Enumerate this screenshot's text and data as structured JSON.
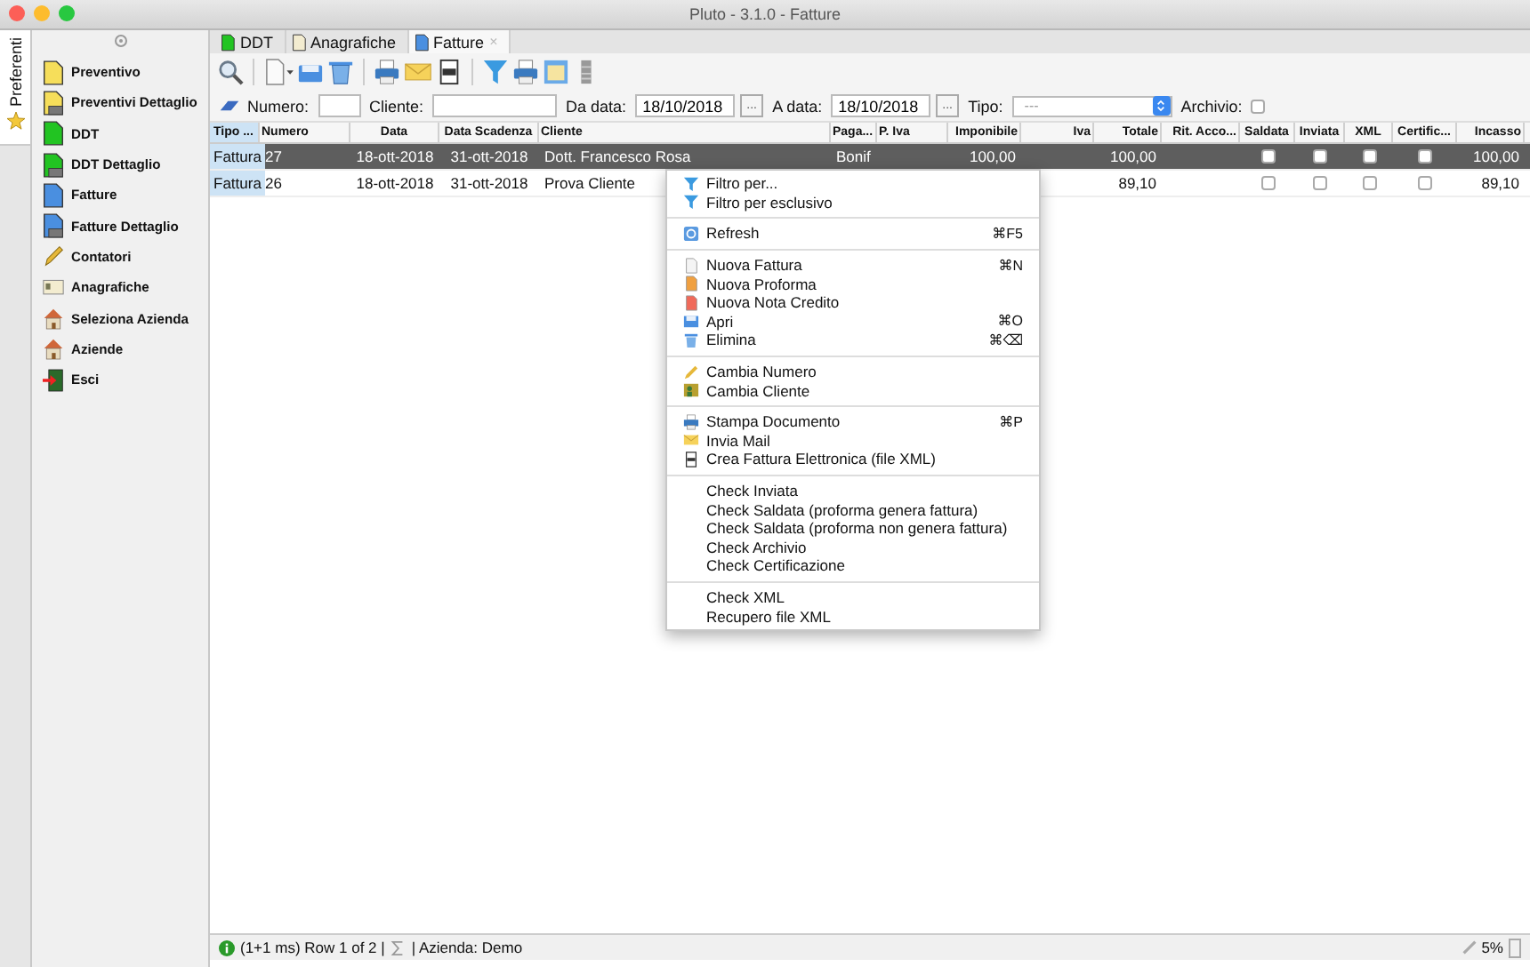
{
  "window": {
    "title": "Pluto - 3.1.0 - Fatture"
  },
  "side_tab": {
    "label": "Preferenti",
    "selected": true
  },
  "sidebar": {
    "items": [
      {
        "label": "Preventivo"
      },
      {
        "label": "Preventivi Dettaglio"
      },
      {
        "label": "DDT"
      },
      {
        "label": "DDT Dettaglio"
      },
      {
        "label": "Fatture"
      },
      {
        "label": "Fatture Dettaglio"
      },
      {
        "label": "Contatori"
      },
      {
        "label": "Anagrafiche"
      },
      {
        "label": "Seleziona Azienda"
      },
      {
        "label": "Aziende"
      },
      {
        "label": "Esci"
      }
    ]
  },
  "tabs": [
    {
      "label": "DDT",
      "selected": false
    },
    {
      "label": "Anagrafiche",
      "selected": false
    },
    {
      "label": "Fatture",
      "selected": true,
      "close": "×"
    }
  ],
  "filters": {
    "numero_label": "Numero:",
    "cliente_label": "Cliente:",
    "da_data_label": "Da data:",
    "da_data": "18/10/2018",
    "a_data_label": "A data:",
    "a_data": "18/10/2018",
    "browse": "...",
    "tipo_label": "Tipo:",
    "tipo": "---",
    "archivio_label": "Archivio:",
    "archivio": false
  },
  "table": {
    "columns": [
      {
        "label": "Tipo ...",
        "kind": "tag"
      },
      {
        "label": "Numero",
        "kind": "text"
      },
      {
        "label": "Data",
        "kind": "date"
      },
      {
        "label": "Data Scadenza",
        "kind": "date"
      },
      {
        "label": "Cliente",
        "kind": "text"
      },
      {
        "label": "Paga...",
        "kind": "text"
      },
      {
        "label": "P. Iva",
        "kind": "text"
      },
      {
        "label": "Imponibile",
        "kind": "number"
      },
      {
        "label": "Iva",
        "kind": "number"
      },
      {
        "label": "Totale",
        "kind": "number"
      },
      {
        "label": "Rit. Acco...",
        "kind": "number"
      },
      {
        "label": "Saldata",
        "kind": "check"
      },
      {
        "label": "Inviata",
        "kind": "check"
      },
      {
        "label": "XML",
        "kind": "check"
      },
      {
        "label": "Certific...",
        "kind": "check"
      },
      {
        "label": "Incasso",
        "kind": "number"
      }
    ],
    "rows": [
      {
        "selected": true,
        "cells": [
          "Fattura",
          "27",
          "18-ott-2018",
          "31-ott-2018",
          "Dott. Francesco Rosa",
          "Bonif",
          null,
          "100,00",
          null,
          "100,00",
          null,
          {
            "checked": false
          },
          {
            "checked": false
          },
          {
            "checked": false
          },
          {
            "checked": false
          },
          "100,00"
        ]
      },
      {
        "selected": false,
        "cells": [
          "Fattura",
          "26",
          "18-ott-2018",
          "31-ott-2018",
          "Prova Cliente",
          null,
          null,
          null,
          null,
          "89,10",
          null,
          {
            "checked": false
          },
          {
            "checked": false
          },
          {
            "checked": false
          },
          {
            "checked": false
          },
          "89,10"
        ]
      }
    ]
  },
  "context_menu": {
    "groups": [
      [
        {
          "label": "Filtro per..."
        },
        {
          "label": "Filtro per esclusivo"
        }
      ],
      [
        {
          "label": "Refresh",
          "shortcut": "⌘F5"
        }
      ],
      [
        {
          "label": "Nuova Fattura",
          "shortcut": "⌘N"
        },
        {
          "label": "Nuova Proforma"
        },
        {
          "label": "Nuova Nota Credito"
        },
        {
          "label": "Apri",
          "shortcut": "⌘O"
        },
        {
          "label": "Elimina",
          "shortcut": "⌘⌫"
        }
      ],
      [
        {
          "label": "Cambia Numero"
        },
        {
          "label": "Cambia Cliente"
        }
      ],
      [
        {
          "label": "Stampa Documento",
          "shortcut": "⌘P"
        },
        {
          "label": "Invia Mail"
        },
        {
          "label": "Crea Fattura Elettronica (file XML)"
        }
      ],
      [
        {
          "label": "Check Inviata"
        },
        {
          "label": "Check Saldata (proforma genera fattura)"
        },
        {
          "label": "Check Saldata (proforma non genera fattura)"
        },
        {
          "label": "Check Archivio"
        },
        {
          "label": "Check Certificazione"
        }
      ],
      [
        {
          "label": "Check XML"
        },
        {
          "label": "Recupero file XML"
        }
      ]
    ]
  },
  "status_bar": {
    "info": "(1+1 ms) Row 1 of 2 |",
    "azienda": "| Azienda: Demo",
    "memory": "5%"
  }
}
